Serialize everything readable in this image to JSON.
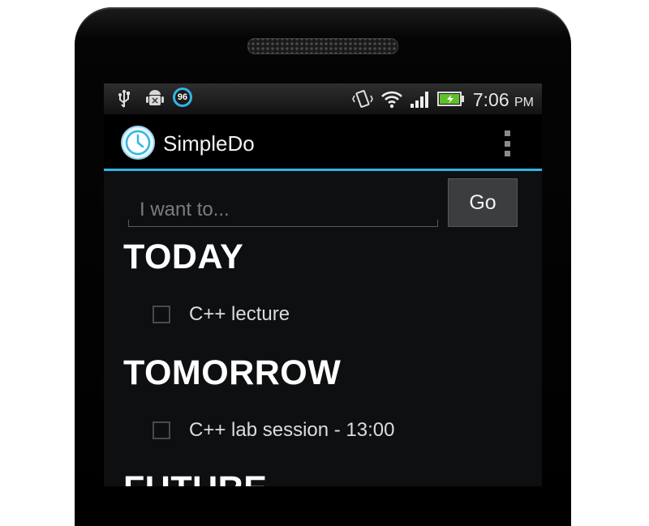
{
  "status_bar": {
    "icons": [
      "usb-icon",
      "android-debug-icon",
      "battery-badge-icon",
      "vibrate-icon",
      "wifi-icon",
      "signal-icon",
      "battery-icon"
    ],
    "badge_value": "96",
    "time": "7:06",
    "ampm": "PM"
  },
  "action_bar": {
    "app_icon": "clock-icon",
    "title": "SimpleDo",
    "overflow_icon": "overflow-menu-icon",
    "accent_color": "#33b5e5"
  },
  "input": {
    "placeholder": "I want to...",
    "value": ""
  },
  "go_button": {
    "label": "Go"
  },
  "sections": [
    {
      "title": "TODAY",
      "tasks": [
        {
          "label": "C++ lecture",
          "checked": false
        }
      ]
    },
    {
      "title": "TOMORROW",
      "tasks": [
        {
          "label": "C++ lab session - 13:00",
          "checked": false
        }
      ]
    },
    {
      "title": "FUTURE",
      "tasks": []
    }
  ]
}
